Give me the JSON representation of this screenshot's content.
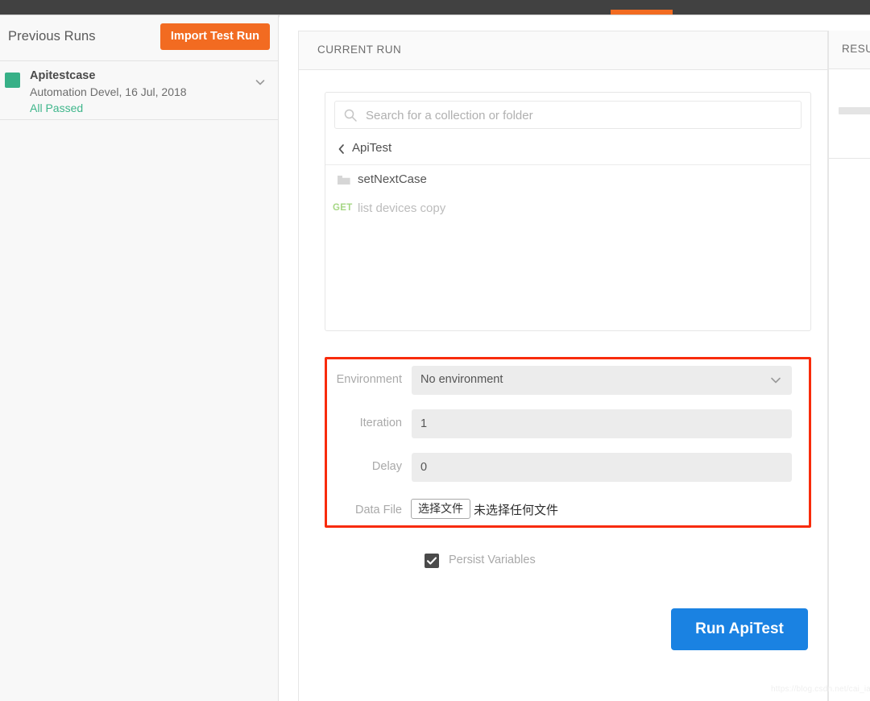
{
  "topbar": {
    "tab_indicator_color": "#f26b21",
    "background_color": "#414141"
  },
  "sidebar": {
    "title": "Previous Runs",
    "import_button_label": "Import Test Run",
    "import_button_color": "#f26b21",
    "runs": [
      {
        "name": "Apitestcase",
        "meta": "Automation Devel, 16 Jul, 2018",
        "result": "All Passed",
        "result_color": "#3fb68b",
        "status_color": "#37b087",
        "chevron_icon": "chevron-down-icon"
      }
    ]
  },
  "main": {
    "header_title": "CURRENT RUN",
    "chooser": {
      "search_placeholder": "Search for a collection or folder",
      "search_value": "",
      "search_icon": "search-icon",
      "breadcrumb": {
        "back_icon": "chevron-left-icon",
        "label": "ApiTest"
      },
      "items": [
        {
          "type": "folder",
          "icon": "folder-icon",
          "label": "setNextCase",
          "method": ""
        },
        {
          "type": "request",
          "icon": "",
          "label": "list devices copy",
          "method": "GET",
          "method_color": "#a6d785"
        }
      ]
    },
    "highlight": {
      "color": "#f82b0b",
      "note": "red annotation rectangle around run configuration fields"
    },
    "form": {
      "environment": {
        "label": "Environment",
        "value": "No environment",
        "chevron_icon": "chevron-down-icon"
      },
      "iteration": {
        "label": "Iteration",
        "value": "1"
      },
      "delay": {
        "label": "Delay",
        "value": "0"
      },
      "data_file": {
        "label": "Data File",
        "button_label": "选择文件",
        "status_text": "未选择任何文件"
      }
    },
    "persist": {
      "label": "Persist Variables",
      "checked": true,
      "check_icon": "check-icon"
    },
    "run_button": {
      "label": "Run ApiTest",
      "color": "#1a82e2"
    }
  },
  "results": {
    "header_title": "RESULTS"
  },
  "watermark": {
    "text": "https://blog.csdn.net/cai_iac"
  }
}
